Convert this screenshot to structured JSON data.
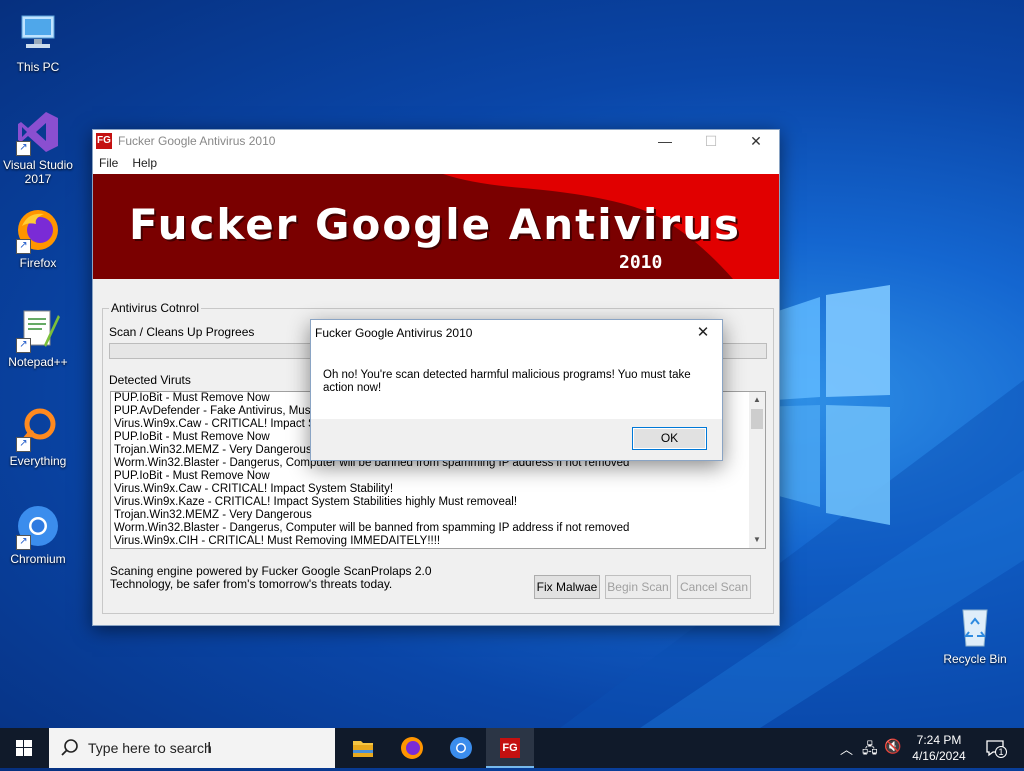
{
  "desktop": {
    "icons": [
      {
        "label": "This PC"
      },
      {
        "label": "Visual Studio 2017"
      },
      {
        "label": "Firefox"
      },
      {
        "label": "Notepad++"
      },
      {
        "label": "Everything"
      },
      {
        "label": "Chromium"
      },
      {
        "label": "Recycle Bin"
      }
    ]
  },
  "window": {
    "title": "Fucker Google Antivirus 2010",
    "app_icon_text": "FG",
    "menu": [
      "File",
      "Help"
    ],
    "banner": {
      "title": "Fucker Google Antivirus",
      "year": "2010"
    },
    "group_label": "Antivirus Cotnrol",
    "progress_label": "Scan / Cleans Up Progrees",
    "progress_value": 0,
    "detected_label": "Detected Viruts",
    "detected_items": [
      "PUP.IoBit - Must Remove Now",
      "PUP.AvDefender - Fake Antivirus, Must Be Removed",
      "Virus.Win9x.Caw - CRITICAL! Impact System Stability!",
      "PUP.IoBit - Must Remove Now",
      "Trojan.Win32.MEMZ - Very Dangerous",
      "Worm.Win32.Blaster - Dangerus, Computer will be banned from spamming IP address if not removed",
      "PUP.IoBit - Must Remove Now",
      "Virus.Win9x.Caw - CRITICAL! Impact System Stability!",
      "Virus.Win9x.Kaze - CRITICAL! Impact System Stabilities highly Must removeal!",
      "Trojan.Win32.MEMZ - Very Dangerous",
      "Worm.Win32.Blaster - Dangerus, Computer will be banned from spamming IP address if not removed",
      "Virus.Win9x.CIH - CRITICAL! Must Removing IMMEDAITELY!!!!"
    ],
    "engine_note": "Scaning engine powered by Fucker Google ScanProlaps 2.0 Technology, be safer from's tomorrow's threats today.",
    "buttons": {
      "fix": "Fix Malwae",
      "begin": "Begin Scan",
      "cancel": "Cancel Scan"
    }
  },
  "dialog": {
    "title": "Fucker Google Antivirus 2010",
    "message": "Oh no! You're scan detected harmful malicious programs! Yuo must take action now!",
    "ok": "OK"
  },
  "taskbar": {
    "search_placeholder": "Type here to search",
    "time": "7:24 PM",
    "date": "4/16/2024",
    "notification_count": "1",
    "active_app_text": "FG"
  },
  "colors": {
    "accent": "#0078d7",
    "banner_red": "#e00000",
    "banner_dark": "#7a0000",
    "taskbar": "#101a2a"
  }
}
